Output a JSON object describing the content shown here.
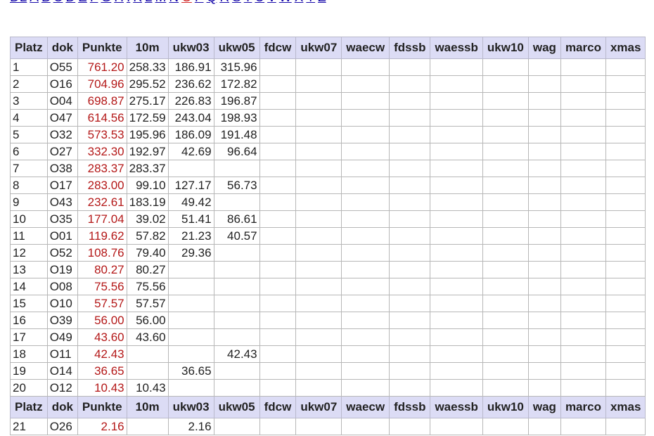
{
  "nav": {
    "letters": [
      "DL",
      "A",
      "B",
      "C",
      "D",
      "E",
      "F",
      "G",
      "H",
      "I",
      "K",
      "L",
      "M",
      "N",
      "O",
      "P",
      "Q",
      "R",
      "S",
      "T",
      "U",
      "V",
      "W",
      "X",
      "Y",
      "Z"
    ],
    "current": "O"
  },
  "table": {
    "headers": [
      "Platz",
      "dok",
      "Punkte",
      "10m",
      "ukw03",
      "ukw05",
      "fdcw",
      "ukw07",
      "waecw",
      "fdssb",
      "waessb",
      "ukw10",
      "wag",
      "marco",
      "xmas"
    ],
    "rows": [
      [
        "1",
        "O55",
        "761.20",
        "258.33",
        "186.91",
        "315.96",
        "",
        "",
        "",
        "",
        "",
        "",
        "",
        "",
        ""
      ],
      [
        "2",
        "O16",
        "704.96",
        "295.52",
        "236.62",
        "172.82",
        "",
        "",
        "",
        "",
        "",
        "",
        "",
        "",
        ""
      ],
      [
        "3",
        "O04",
        "698.87",
        "275.17",
        "226.83",
        "196.87",
        "",
        "",
        "",
        "",
        "",
        "",
        "",
        "",
        ""
      ],
      [
        "4",
        "O47",
        "614.56",
        "172.59",
        "243.04",
        "198.93",
        "",
        "",
        "",
        "",
        "",
        "",
        "",
        "",
        ""
      ],
      [
        "5",
        "O32",
        "573.53",
        "195.96",
        "186.09",
        "191.48",
        "",
        "",
        "",
        "",
        "",
        "",
        "",
        "",
        ""
      ],
      [
        "6",
        "O27",
        "332.30",
        "192.97",
        "42.69",
        "96.64",
        "",
        "",
        "",
        "",
        "",
        "",
        "",
        "",
        ""
      ],
      [
        "7",
        "O38",
        "283.37",
        "283.37",
        "",
        "",
        "",
        "",
        "",
        "",
        "",
        "",
        "",
        "",
        ""
      ],
      [
        "8",
        "O17",
        "283.00",
        "99.10",
        "127.17",
        "56.73",
        "",
        "",
        "",
        "",
        "",
        "",
        "",
        "",
        ""
      ],
      [
        "9",
        "O43",
        "232.61",
        "183.19",
        "49.42",
        "",
        "",
        "",
        "",
        "",
        "",
        "",
        "",
        "",
        ""
      ],
      [
        "10",
        "O35",
        "177.04",
        "39.02",
        "51.41",
        "86.61",
        "",
        "",
        "",
        "",
        "",
        "",
        "",
        "",
        ""
      ],
      [
        "11",
        "O01",
        "119.62",
        "57.82",
        "21.23",
        "40.57",
        "",
        "",
        "",
        "",
        "",
        "",
        "",
        "",
        ""
      ],
      [
        "12",
        "O52",
        "108.76",
        "79.40",
        "29.36",
        "",
        "",
        "",
        "",
        "",
        "",
        "",
        "",
        "",
        ""
      ],
      [
        "13",
        "O19",
        "80.27",
        "80.27",
        "",
        "",
        "",
        "",
        "",
        "",
        "",
        "",
        "",
        "",
        ""
      ],
      [
        "14",
        "O08",
        "75.56",
        "75.56",
        "",
        "",
        "",
        "",
        "",
        "",
        "",
        "",
        "",
        "",
        ""
      ],
      [
        "15",
        "O10",
        "57.57",
        "57.57",
        "",
        "",
        "",
        "",
        "",
        "",
        "",
        "",
        "",
        "",
        ""
      ],
      [
        "16",
        "O39",
        "56.00",
        "56.00",
        "",
        "",
        "",
        "",
        "",
        "",
        "",
        "",
        "",
        "",
        ""
      ],
      [
        "17",
        "O49",
        "43.60",
        "43.60",
        "",
        "",
        "",
        "",
        "",
        "",
        "",
        "",
        "",
        "",
        ""
      ],
      [
        "18",
        "O11",
        "42.43",
        "",
        "",
        "42.43",
        "",
        "",
        "",
        "",
        "",
        "",
        "",
        "",
        ""
      ],
      [
        "19",
        "O14",
        "36.65",
        "",
        "36.65",
        "",
        "",
        "",
        "",
        "",
        "",
        "",
        "",
        "",
        ""
      ],
      [
        "20",
        "O12",
        "10.43",
        "10.43",
        "",
        "",
        "",
        "",
        "",
        "",
        "",
        "",
        "",
        "",
        ""
      ],
      [
        "21",
        "O26",
        "2.16",
        "",
        "2.16",
        "",
        "",
        "",
        "",
        "",
        "",
        "",
        "",
        "",
        ""
      ]
    ],
    "repeat_header_after": 20
  },
  "colors": {
    "link": "#1a0dab",
    "current_link": "#d12b2b",
    "points": "#b41818",
    "header_bg": "#dcdcf5"
  }
}
